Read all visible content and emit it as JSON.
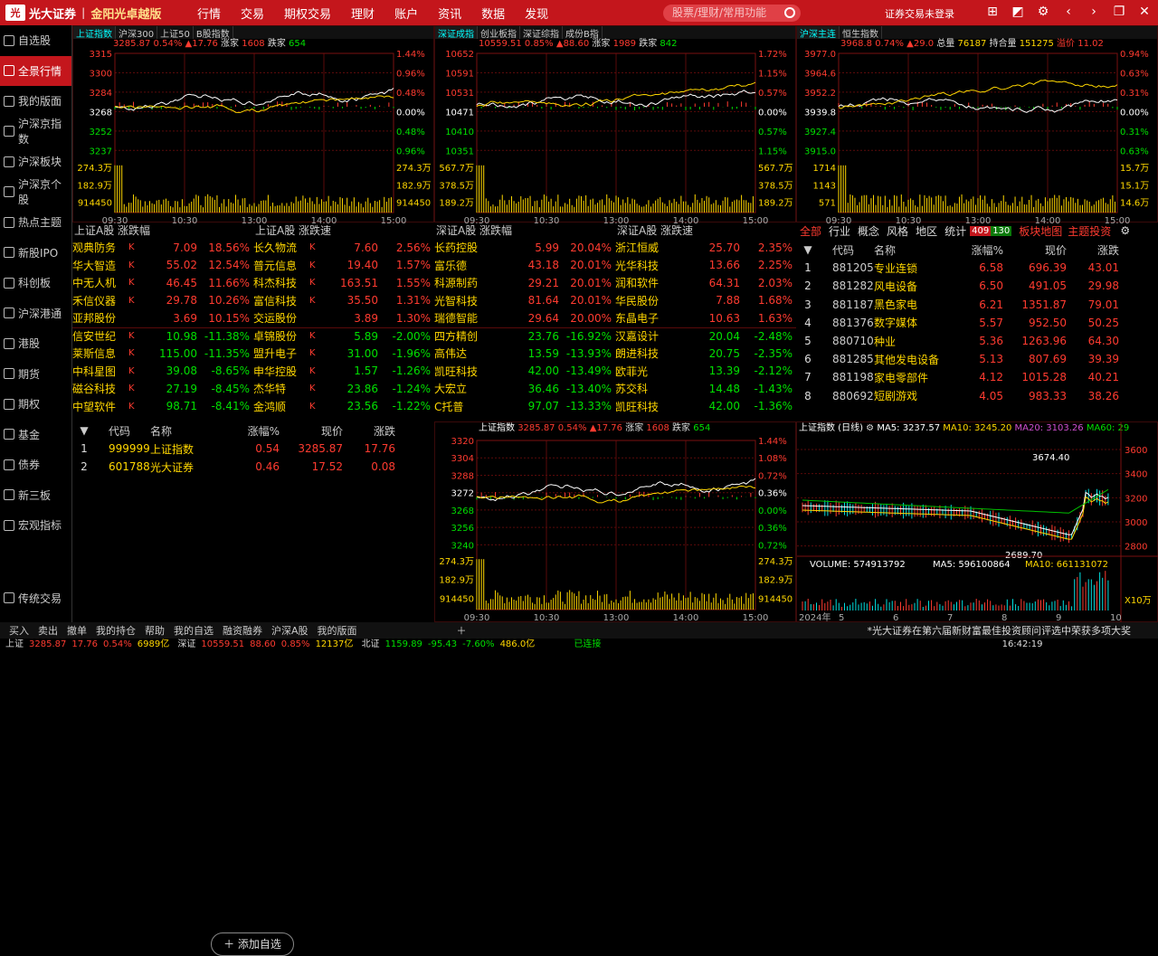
{
  "app": {
    "brand": "光大证券",
    "slogan": "金阳光卓越版",
    "menu": [
      "行情",
      "交易",
      "期权交易",
      "理财",
      "账户",
      "资讯",
      "数据",
      "发现"
    ],
    "search_placeholder": "股票/理财/常用功能",
    "login": "证券交易未登录"
  },
  "sidebar": [
    "自选股",
    "全景行情",
    "我的版面",
    "沪深京指数",
    "沪深板块",
    "沪深京个股",
    "热点主题",
    "新股IPO",
    "科创板",
    "沪深港通",
    "港股",
    "期货",
    "期权",
    "基金",
    "债券",
    "新三板",
    "宏观指标"
  ],
  "sidebar_bottom": "传统交易",
  "chart1": {
    "tabs": [
      "上证指数",
      "沪深300",
      "上证50",
      "B股指数"
    ],
    "info": [
      "3285.87",
      "0.54%",
      "▲17.76",
      "涨家",
      "1608",
      "跌家",
      "654"
    ],
    "yleft": [
      "3315",
      "3300",
      "3284",
      "3268",
      "3252",
      "3237"
    ],
    "yright": [
      "1.44%",
      "0.96%",
      "0.48%",
      "0.00%",
      "0.48%",
      "0.96%"
    ],
    "vol": [
      "274.3万",
      "182.9万",
      "914450"
    ],
    "times": [
      "09:30",
      "10:30",
      "13:00",
      "14:00",
      "15:00"
    ]
  },
  "chart2": {
    "tabs": [
      "深证成指",
      "创业板指",
      "深证综指",
      "成份B指"
    ],
    "info": [
      "10559.51",
      "0.85%",
      "▲88.60",
      "涨家",
      "1989",
      "跌家",
      "842"
    ],
    "yleft": [
      "10652",
      "10591",
      "10531",
      "10471",
      "10410",
      "10351"
    ],
    "yright": [
      "1.72%",
      "1.15%",
      "0.57%",
      "0.00%",
      "0.57%",
      "1.15%"
    ],
    "vol": [
      "567.7万",
      "378.5万",
      "189.2万"
    ],
    "times": [
      "09:30",
      "10:30",
      "13:00",
      "14:00",
      "15:00"
    ]
  },
  "chart3": {
    "tabs": [
      "沪深主连",
      "恒生指数"
    ],
    "info": [
      "3968.8",
      "0.74%",
      "▲29.0",
      "总量",
      "76187",
      "持合量",
      "151275",
      "溢价",
      "11.02"
    ],
    "yleft": [
      "3977.0",
      "3964.6",
      "3952.2",
      "3939.8",
      "3927.4",
      "3915.0"
    ],
    "yright": [
      "0.94%",
      "0.63%",
      "0.31%",
      "0.00%",
      "0.31%",
      "0.63%"
    ],
    "vol": [
      "1714",
      "1143",
      "571"
    ],
    "volr": [
      "15.7万",
      "15.1万",
      "14.6万"
    ],
    "times": [
      "09:30",
      "10:30",
      "13:00",
      "14:00",
      "15:00"
    ]
  },
  "rank_sh": {
    "title": "上证A股 涨跌幅",
    "rows": [
      [
        "观典防务",
        "7.09",
        "18.56%"
      ],
      [
        "华大智造",
        "55.02",
        "12.54%"
      ],
      [
        "中无人机",
        "46.45",
        "11.66%"
      ],
      [
        "禾信仪器",
        "29.78",
        "10.26%"
      ],
      [
        "亚邦股份",
        "3.69",
        "10.15%"
      ],
      [
        "信安世纪",
        "10.98",
        "-11.38%"
      ],
      [
        "莱斯信息",
        "115.00",
        "-11.35%"
      ],
      [
        "中科星图",
        "39.08",
        "-8.65%"
      ],
      [
        "磁谷科技",
        "27.19",
        "-8.45%"
      ],
      [
        "中望软件",
        "98.71",
        "-8.41%"
      ]
    ]
  },
  "rank_sh2": {
    "title": "上证A股 涨跌速",
    "rows": [
      [
        "长久物流",
        "7.60",
        "2.56%"
      ],
      [
        "普元信息",
        "19.40",
        "1.57%"
      ],
      [
        "科杰科技",
        "163.51",
        "1.55%"
      ],
      [
        "富信科技",
        "35.50",
        "1.31%"
      ],
      [
        "交运股份",
        "3.89",
        "1.30%"
      ],
      [
        "卓锦股份",
        "5.89",
        "-2.00%"
      ],
      [
        "盟升电子",
        "31.00",
        "-1.96%"
      ],
      [
        "申华控股",
        "1.57",
        "-1.26%"
      ],
      [
        "杰华特",
        "23.86",
        "-1.24%"
      ],
      [
        "金鸿顺",
        "23.56",
        "-1.22%"
      ]
    ]
  },
  "rank_sz": {
    "title": "深证A股 涨跌幅",
    "rows": [
      [
        "长药控股",
        "5.99",
        "20.04%"
      ],
      [
        "富乐德",
        "43.18",
        "20.01%"
      ],
      [
        "科源制药",
        "29.21",
        "20.01%"
      ],
      [
        "光智科技",
        "81.64",
        "20.01%"
      ],
      [
        "瑞德智能",
        "29.64",
        "20.00%"
      ],
      [
        "四方精创",
        "23.76",
        "-16.92%"
      ],
      [
        "高伟达",
        "13.59",
        "-13.93%"
      ],
      [
        "凯旺科技",
        "42.00",
        "-13.49%"
      ],
      [
        "大宏立",
        "36.46",
        "-13.40%"
      ],
      [
        "C托普",
        "97.07",
        "-13.33%"
      ]
    ]
  },
  "rank_sz2": {
    "title": "深证A股 涨跌速",
    "rows": [
      [
        "浙江恒威",
        "25.70",
        "2.35%"
      ],
      [
        "光华科技",
        "13.66",
        "2.25%"
      ],
      [
        "润和软件",
        "64.31",
        "2.03%"
      ],
      [
        "华民股份",
        "7.88",
        "1.68%"
      ],
      [
        "东晶电子",
        "10.63",
        "1.63%"
      ],
      [
        "汉嘉设计",
        "20.04",
        "-2.48%"
      ],
      [
        "朗进科技",
        "20.75",
        "-2.35%"
      ],
      [
        "欧菲光",
        "13.39",
        "-2.12%"
      ],
      [
        "苏交科",
        "14.48",
        "-1.43%"
      ],
      [
        "凯旺科技",
        "42.00",
        "-1.36%"
      ]
    ]
  },
  "watch": {
    "headers": [
      "代码",
      "名称",
      "涨幅%",
      "现价",
      "涨跌"
    ],
    "rows": [
      [
        "1",
        "999999",
        "上证指数",
        "0.54",
        "3285.87",
        "17.76"
      ],
      [
        "2",
        "601788",
        "光大证券",
        "0.46",
        "17.52",
        "0.08"
      ]
    ],
    "add": "添加自选"
  },
  "sector": {
    "tabs": [
      "全部",
      "行业",
      "概念",
      "风格",
      "地区",
      "统计"
    ],
    "badge1": "409",
    "badge2": "130",
    "links": [
      "板块地图",
      "主题投资"
    ],
    "headers": [
      "代码",
      "名称",
      "涨幅%",
      "现价",
      "涨跌"
    ],
    "rows": [
      [
        "1",
        "881205",
        "专业连锁",
        "6.58",
        "696.39",
        "43.01"
      ],
      [
        "2",
        "881282",
        "风电设备",
        "6.50",
        "491.05",
        "29.98"
      ],
      [
        "3",
        "881187",
        "黑色家电",
        "6.21",
        "1351.87",
        "79.01"
      ],
      [
        "4",
        "881376",
        "数字媒体",
        "5.57",
        "952.50",
        "50.25"
      ],
      [
        "5",
        "880710",
        "种业",
        "5.36",
        "1263.96",
        "64.30"
      ],
      [
        "6",
        "881285",
        "其他发电设备",
        "5.13",
        "807.69",
        "39.39"
      ],
      [
        "7",
        "881198",
        "家电零部件",
        "4.12",
        "1015.28",
        "40.21"
      ],
      [
        "8",
        "880692",
        "短剧游戏",
        "4.05",
        "983.33",
        "38.26"
      ]
    ]
  },
  "chart4": {
    "info": [
      "上证指数",
      "3285.87",
      "0.54%",
      "▲17.76",
      "涨家",
      "1608",
      "跌家",
      "654"
    ],
    "yleft": [
      "3320",
      "3304",
      "3288",
      "3272",
      "3268",
      "3256",
      "3240"
    ],
    "yright": [
      "1.44%",
      "1.08%",
      "0.72%",
      "0.36%",
      "0.00%",
      "0.36%",
      "0.72%",
      "1.08%"
    ],
    "vol": [
      "274.3万",
      "182.9万",
      "914450"
    ],
    "times": [
      "09:30",
      "10:30",
      "13:00",
      "14:00",
      "15:00"
    ]
  },
  "kline": {
    "title": "上证指数 (日线)",
    "ma": [
      "MA5: 3237.57",
      "MA10: 3245.20",
      "MA20: 3103.26",
      "MA60: 29"
    ],
    "high": "3674.40",
    "low": "2689.70",
    "yr": [
      "3600",
      "3400",
      "3200",
      "3000",
      "2800"
    ],
    "vol": "VOLUME: 574913792",
    "vma": [
      "MA5: 596100864",
      "MA10: 661131072"
    ],
    "unit": "X10万",
    "year": "2024年",
    "months": [
      "5",
      "6",
      "7",
      "8",
      "9",
      "10"
    ]
  },
  "bottombar": [
    "买入",
    "卖出",
    "撤单",
    "我的持仓",
    "帮助",
    "我的自选",
    "融资融券",
    "沪深A股",
    "我的版面"
  ],
  "notice": "*光大证券在第六届新财富最佳投资顾问评选中荣获多项大奖",
  "status": {
    "sh": "上证",
    "sh_v": "3285.87",
    "sh_c": "17.76",
    "sh_p": "0.54%",
    "sh_amt": "6989亿",
    "sz": "深证",
    "sz_v": "10559.51",
    "sz_c": "88.60",
    "sz_p": "0.85%",
    "sz_amt": "12137亿",
    "bz": "北证",
    "bz_v": "1159.89",
    "bz_c": "-95.43",
    "bz_p": "-7.60%",
    "bz_amt": "486.0亿",
    "conn": "已连接",
    "time": "16:42:19"
  },
  "colors": {
    "brand_red": "#c4161c",
    "up": "#ff3b30",
    "down": "#00e000",
    "name": "#ffd700"
  }
}
